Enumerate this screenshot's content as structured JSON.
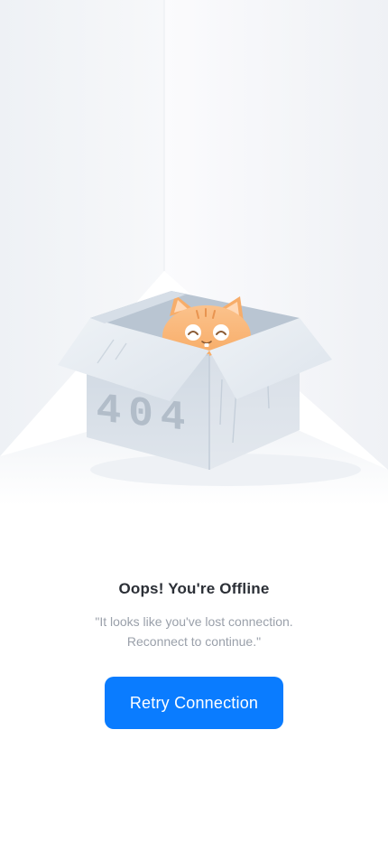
{
  "illustration": {
    "box_label": "404"
  },
  "offline": {
    "title": "Oops! You're Offline",
    "message_line1": "\"It looks like you've lost connection.",
    "message_line2": "Reconnect to continue.\""
  },
  "actions": {
    "retry_label": "Retry Connection"
  },
  "colors": {
    "accent": "#0a7cff",
    "title": "#2b2f36",
    "muted": "#9aa0aa"
  }
}
